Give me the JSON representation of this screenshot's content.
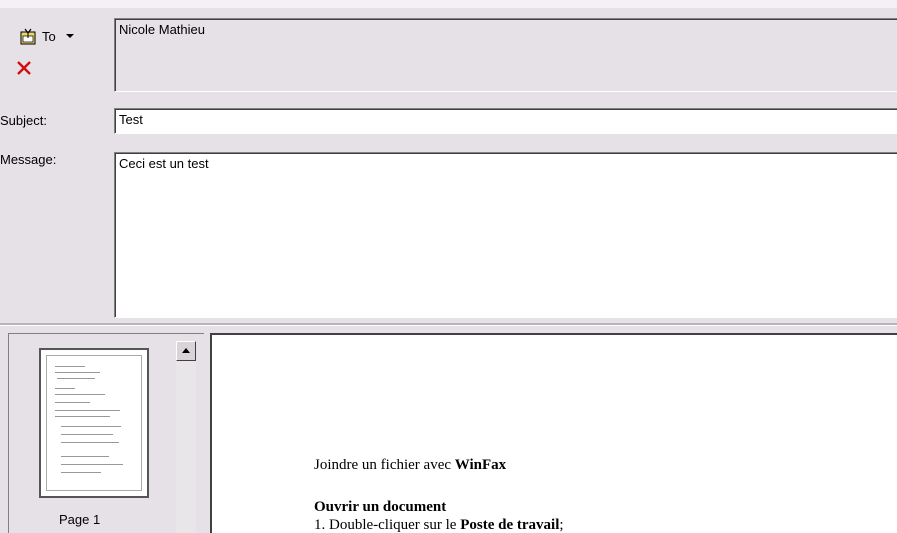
{
  "header": {
    "to_label": "To",
    "to_value": "Nicole Mathieu",
    "subject_label": "Subject:",
    "subject_value": "Test",
    "message_label": "Message:",
    "message_value": "Ceci est un test"
  },
  "thumbnails": {
    "page_label": "Page 1"
  },
  "document": {
    "line1_prefix": "Joindre un fichier avec ",
    "line1_bold": "WinFax",
    "heading": "Ouvrir un document",
    "item1_prefix": "1.   Double-cliquer sur le ",
    "item1_bold": "Poste de travail",
    "item1_suffix": ";"
  },
  "icons": {
    "address_book": "address-book-icon",
    "remove": "remove-recipient-icon",
    "dropdown": "chevron-down-icon"
  },
  "colors": {
    "background": "#e6e1e6",
    "remove_icon": "#d01010"
  }
}
